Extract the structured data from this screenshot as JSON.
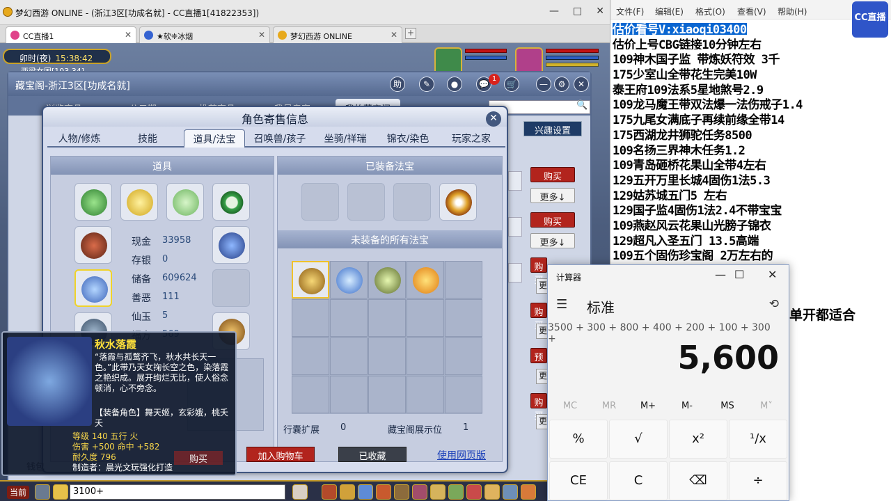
{
  "browser": {
    "title": "梦幻西游 ONLINE - (浙江3区[功成名就] - CC直播1[41822353])",
    "win_min": "—",
    "win_max": "□",
    "win_close": "✕",
    "tabs": [
      {
        "label": "CC直播1",
        "color": "#e0438a"
      },
      {
        "label": "★软❈冰烟",
        "color": "#3563d1"
      },
      {
        "label": "梦幻西游 ONLINE",
        "color": "#e7a91c"
      }
    ],
    "tab_add": "+"
  },
  "game": {
    "time_label": "卯时(夜)",
    "time_value": "15:38:42",
    "location": "西梁女国[103,34]",
    "bg_panel_title": "藏宝阁-浙江3区[功成名就]",
    "help_label": "助",
    "bg_tabs": [
      "浏览商品",
      "公示期",
      "推荐商品",
      "我是卖家",
      "我的藏宝阁"
    ],
    "notify_count": "1",
    "interest_button": "兴趣设置",
    "buy_label": "购买",
    "more_label": "更多↓",
    "more_short": "更",
    "side_letter": "预"
  },
  "dialog": {
    "title": "角色寄售信息",
    "close": "✕",
    "tabs": [
      "人物/修炼",
      "技能",
      "道具/法宝",
      "召唤兽/孩子",
      "坐骑/祥瑞",
      "锦衣/染色",
      "玩家之家"
    ],
    "left_header": "道具",
    "right_header_top": "已装备法宝",
    "right_header_bottom": "未装备的所有法宝",
    "stats": [
      {
        "label": "现金",
        "value": "33958"
      },
      {
        "label": "存银",
        "value": "0"
      },
      {
        "label": "储备",
        "value": "609624"
      },
      {
        "label": "善恶",
        "value": "111"
      },
      {
        "label": "仙玉",
        "value": "5"
      },
      {
        "label": "福方",
        "value": "569"
      }
    ],
    "bag_expand_label": "行囊扩展",
    "bag_expand_value": "0",
    "display_label": "藏宝阁展示位",
    "display_value": "1",
    "add_cart": "加入购物车",
    "favorited": "已收藏",
    "web_version": "使用网页版",
    "wallet_label": "钱包"
  },
  "tooltip": {
    "name": "秋水落霞",
    "description": "“落霞与孤鹜齐飞，秋水共长天一色。”此带乃天女掬长空之色，染落霞之艳织成。展开绚烂无比，使人俗念顿消，心不旁念。",
    "equip_role": "【装备角色】舞天姬，玄彩娥，桃夭夭",
    "level_line": "等级 140  五行 火",
    "damage_line": "伤害 +500  命中 +582",
    "durability_line": "耐久度 796",
    "maker_line": "制造者：晨光文玩强化打造",
    "buy_label": "购买"
  },
  "taskbar": {
    "current_label": "当前",
    "input_value": "3100+"
  },
  "notepad": {
    "menu": [
      "文件(F)",
      "编辑(E)",
      "格式(O)",
      "查看(V)",
      "帮助(H)"
    ],
    "logo_text": "CC直播",
    "lines": [
      "估价看号V:xiaoqi03400",
      "估价上号CBG链接10分钟左右",
      "109神木国子监 带炼妖符效 3千",
      "175少室山全带花生完美10W",
      "泰王府109法系5星地煞号2.9",
      "109龙马魔王带双法爆一法伤戒子1.4",
      "175九尾女满底子再续前缘全带14",
      "175西湖龙井狮驼任务8500",
      "109名扬三界神木任务1.2",
      "109青岛砸桥花果山全带4左右",
      "129五开万里长城4固伤1法5.3",
      "129姑苏城五门5 左右",
      "129国子监4固伤1法2.4不带宝宝",
      "109燕赵风云花果山光膀子锦衣",
      "129超凡入圣五门  13.5高端",
      "109五个固伤珍宝阁 2万左右的"
    ],
    "extra_line": "单开都适合"
  },
  "calculator": {
    "title": "计算器",
    "mode": "标准",
    "expression": "3500 + 300 + 800 + 400 + 200 + 100 + 300 +",
    "result": "5,600",
    "memory_buttons": [
      "MC",
      "MR",
      "M+",
      "M-",
      "MS",
      "M˅"
    ],
    "keys_row1": [
      "%",
      "√",
      "x²",
      "¹/x"
    ],
    "keys_row2": [
      "CE",
      "C",
      "⌫",
      "÷"
    ],
    "win_min": "—",
    "win_max": "☐",
    "win_close": "✕"
  }
}
